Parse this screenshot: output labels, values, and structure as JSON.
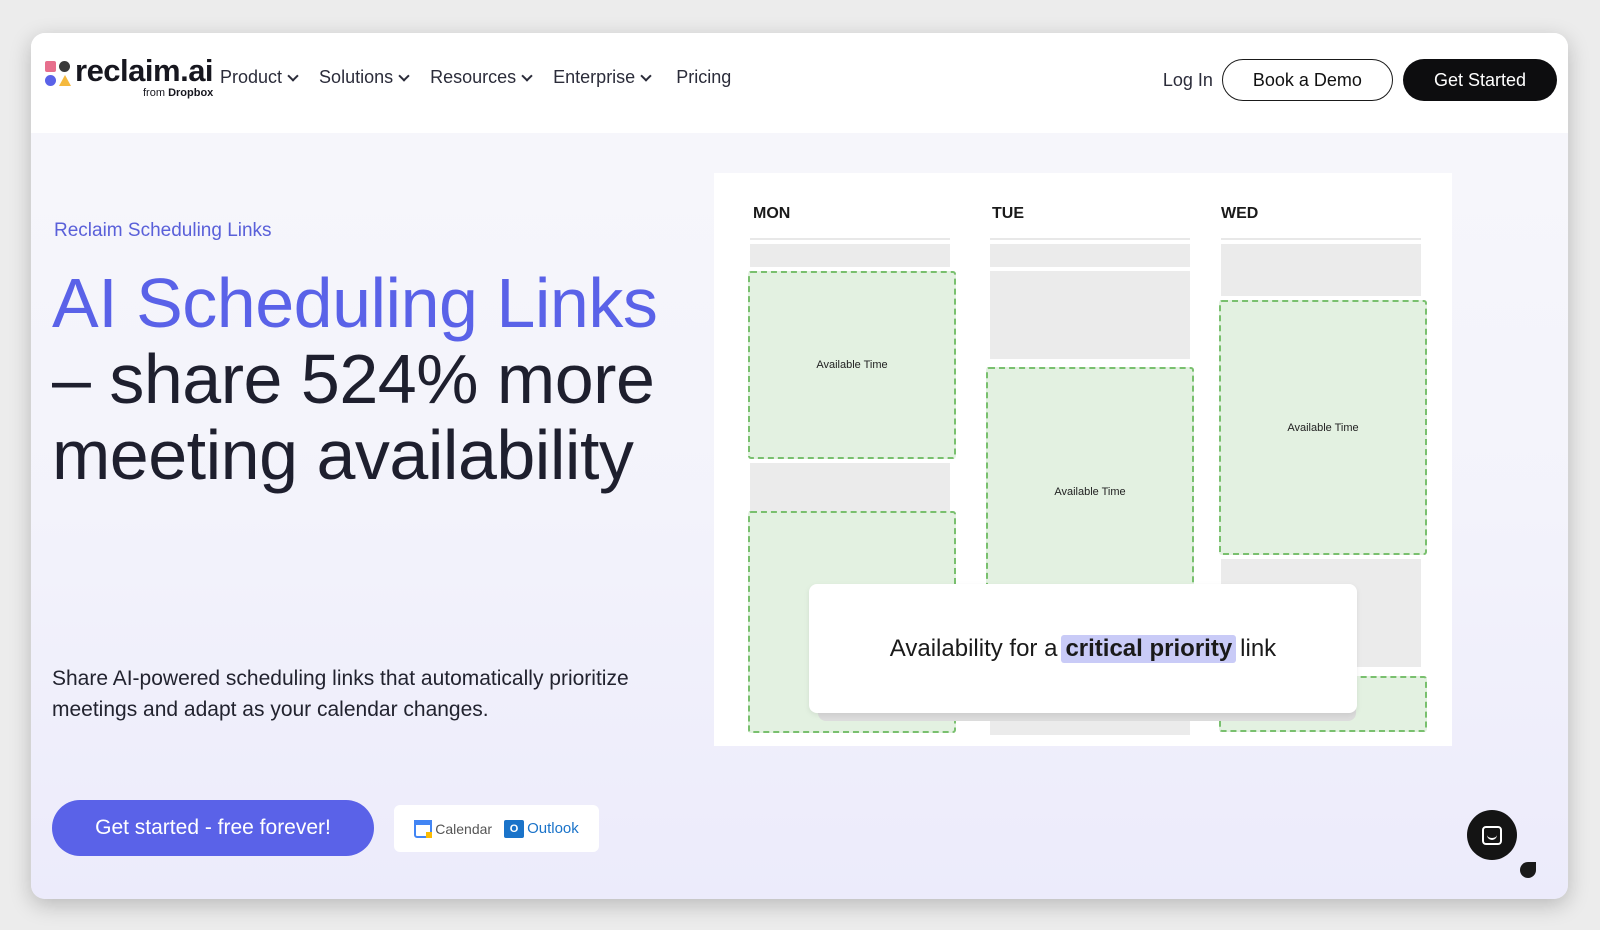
{
  "nav": {
    "logo_text": "reclaim.ai",
    "logo_sub_prefix": "from",
    "logo_sub_brand": "Dropbox",
    "menu": [
      {
        "label": "Product",
        "has_dropdown": true
      },
      {
        "label": "Solutions",
        "has_dropdown": true
      },
      {
        "label": "Resources",
        "has_dropdown": true
      },
      {
        "label": "Enterprise",
        "has_dropdown": true
      },
      {
        "label": "Pricing",
        "has_dropdown": false
      }
    ],
    "login": "Log In",
    "book_demo": "Book a Demo",
    "get_started": "Get Started"
  },
  "hero": {
    "eyebrow": "Reclaim Scheduling Links",
    "headline_accent": "AI Scheduling Links",
    "headline_rest": " – share 524% more meeting availability",
    "description": "Share AI-powered scheduling links that automatically prioritize meetings and adapt as your calendar changes.",
    "cta": "Get started - free forever!",
    "integrations": [
      {
        "icon": "google-calendar-icon",
        "label": "Calendar"
      },
      {
        "icon": "outlook-icon",
        "label": "Outlook"
      }
    ]
  },
  "calendar": {
    "days": [
      "MON",
      "TUE",
      "WED"
    ],
    "available_label": "Available Time",
    "popup": {
      "prefix": "Availability for a",
      "highlight": "critical priority",
      "suffix": "link"
    }
  },
  "colors": {
    "accent": "#5a62e8",
    "available_fill": "#e3f1e1",
    "available_border": "#79c06e",
    "highlight": "#c9cbf7"
  }
}
